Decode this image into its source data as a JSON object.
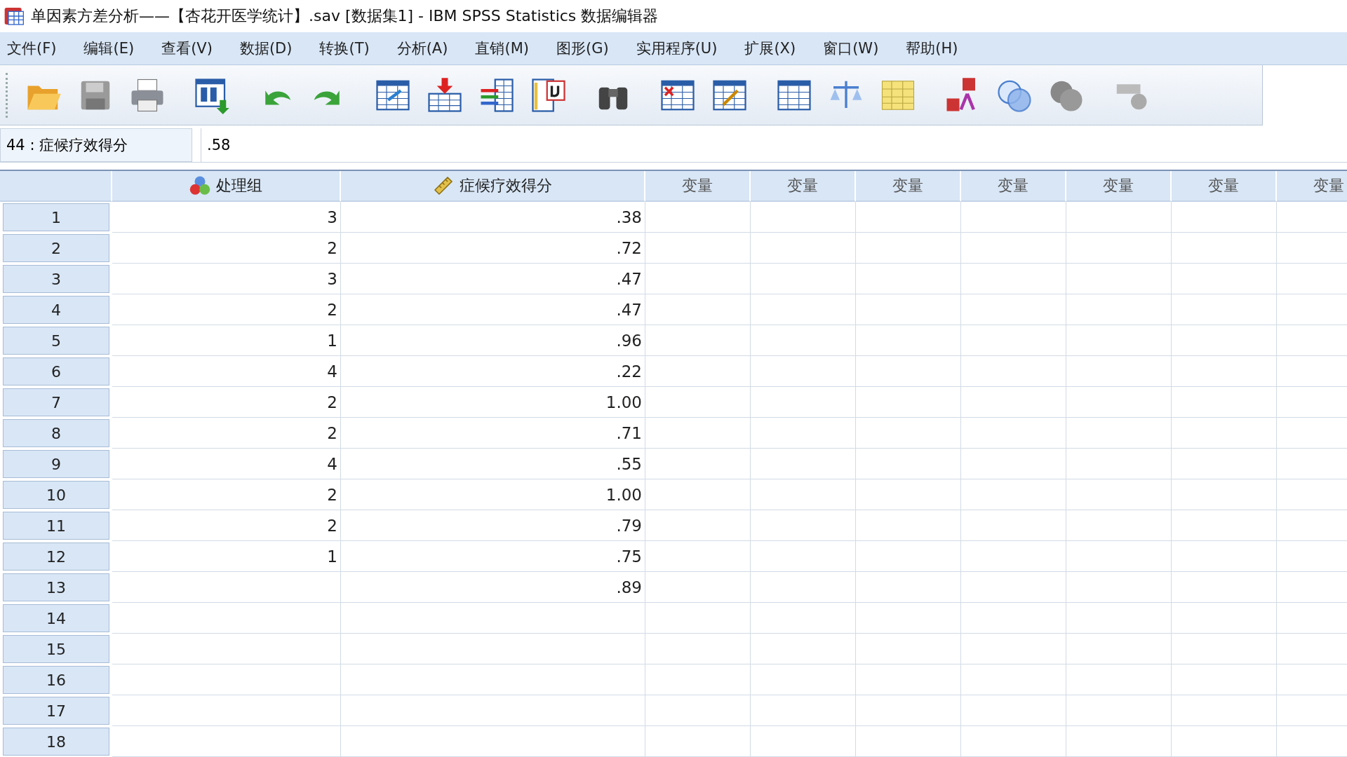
{
  "window": {
    "title": "单因素方差分析——【杏花开医学统计】.sav [数据集1] - IBM SPSS Statistics 数据编辑器"
  },
  "menu": [
    "文件(F)",
    "编辑(E)",
    "查看(V)",
    "数据(D)",
    "转换(T)",
    "分析(A)",
    "直销(M)",
    "图形(G)",
    "实用程序(U)",
    "扩展(X)",
    "窗口(W)",
    "帮助(H)"
  ],
  "cell_editor": {
    "reference": "44 : 症候疗效得分",
    "value": ".58"
  },
  "table": {
    "columns": [
      {
        "label": "处理组",
        "kind": "nominal"
      },
      {
        "label": "症候疗效得分",
        "kind": "scale"
      },
      {
        "label": "变量",
        "kind": "empty"
      },
      {
        "label": "变量",
        "kind": "empty"
      },
      {
        "label": "变量",
        "kind": "empty"
      },
      {
        "label": "变量",
        "kind": "empty"
      },
      {
        "label": "变量",
        "kind": "empty"
      },
      {
        "label": "变量",
        "kind": "empty"
      },
      {
        "label": "变量",
        "kind": "empty"
      }
    ],
    "rows": [
      {
        "number": "1",
        "cells": [
          "3",
          ".38"
        ]
      },
      {
        "number": "2",
        "cells": [
          "2",
          ".72"
        ]
      },
      {
        "number": "3",
        "cells": [
          "3",
          ".47"
        ]
      },
      {
        "number": "4",
        "cells": [
          "2",
          ".47"
        ]
      },
      {
        "number": "5",
        "cells": [
          "1",
          ".96"
        ]
      },
      {
        "number": "6",
        "cells": [
          "4",
          ".22"
        ]
      },
      {
        "number": "7",
        "cells": [
          "2",
          "1.00"
        ]
      },
      {
        "number": "8",
        "cells": [
          "2",
          ".71"
        ]
      },
      {
        "number": "9",
        "cells": [
          "4",
          ".55"
        ]
      },
      {
        "number": "10",
        "cells": [
          "2",
          "1.00"
        ]
      },
      {
        "number": "11",
        "cells": [
          "2",
          ".79"
        ]
      },
      {
        "number": "12",
        "cells": [
          "1",
          ".75"
        ]
      },
      {
        "number": "13",
        "cells": [
          "",
          ".89"
        ]
      },
      {
        "number": "14",
        "cells": [
          "",
          ""
        ]
      },
      {
        "number": "15",
        "cells": [
          "",
          ""
        ]
      },
      {
        "number": "16",
        "cells": [
          "",
          ""
        ]
      },
      {
        "number": "17",
        "cells": [
          "",
          ""
        ]
      },
      {
        "number": "18",
        "cells": [
          "",
          ""
        ]
      }
    ]
  }
}
